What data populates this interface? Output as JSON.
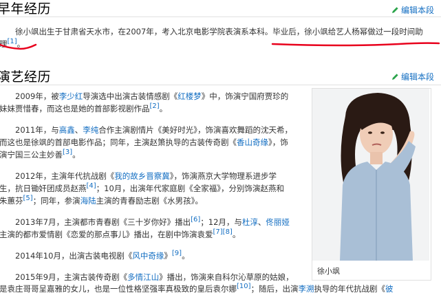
{
  "section1": {
    "title": "早年经历",
    "edit_label": "编辑本段",
    "para": {
      "line1": "徐小飒出生于甘肃省天水市，在2007年，考入北京电影学院表演系本科。毕业后，徐小飒给艺人杨幂做过一段时间助",
      "line2_start": "理",
      "ref": "[1]",
      "line2_end": "。"
    }
  },
  "section2": {
    "title": "演艺经历",
    "edit_label": "编辑本段",
    "paragraphs": {
      "p1": {
        "a": "2009年，被",
        "l1": "李少红",
        "b": "导演选中出演古装情感剧《",
        "l2": "红楼梦",
        "c": "》中，饰演宁国府贾珍的",
        "d": "妹妹贾惜春，而这也是她的首部影视剧作品",
        "ref": "[2]",
        "e": "。"
      },
      "p2": {
        "a": "2011年，与",
        "l1": "高鑫",
        "b": "、",
        "l2": "李纯",
        "c": "合作主演剧情片《美好时光》，饰演喜欢舞蹈的沈天希，",
        "d": "而这也是徐飒的首部电影作品；同年，主演赵箫执导的古装传奇剧《",
        "l3": "香山奇缘",
        "e": "》，饰",
        "f": "演宁国三公主妙善",
        "ref": "[3]",
        "g": "。"
      },
      "p3": {
        "a": "2012年，主演年代抗战剧《",
        "l1": "我的故乡晋察冀",
        "b": "》，饰演燕京大学物理系进步学",
        "c": "生，抗日锄奸团成员赵燕",
        "ref1": "[4]",
        "d": "；10月，出演年代家庭剧《全家福》，分别饰演赵燕和",
        "e": "朱蕙芬",
        "ref2": "[5]",
        "f": "；同年，参演",
        "l2": "海陆",
        "g": "主演的青春励志剧《水男孩》。"
      },
      "p4": {
        "a": "2013年7月，主演都市青春剧《三十岁你好》播出",
        "ref1": "[6]",
        "b": "；12月，与",
        "l1": "杜淳",
        "c": "、",
        "l2": "佟丽娅",
        "d": "主演的都市爱情剧《恋爱的那点事儿》播出，在剧中饰演袁爱",
        "ref2": "[7]",
        "ref3": "[8]",
        "e": "。"
      },
      "p5": {
        "a": "2014年10月，出演古装电视剧《",
        "l1": "风中奇缘",
        "b": "》",
        "ref": "[9]",
        "c": "。"
      },
      "p6": {
        "a": "2015年9月，主演古装传奇剧《",
        "l1": "多情江山",
        "b": "》播出，饰演来自科尔沁草原的姑娘，",
        "c": "是袁庄哥哥呈嘉雅的女儿，也是一位性格坚强率真极致的皇后袁尔娜",
        "ref": "[10]",
        "d": "；随后，出演",
        "l2": "李溯",
        "e": "执导的年代抗战剧《",
        "l3": "彼"
      }
    },
    "photo_caption": "徐小飒"
  },
  "colors": {
    "link": "#136ec2",
    "annotation_red": "#e8001c"
  },
  "icons": {
    "edit": "pencil-icon",
    "photo": "person-photo"
  }
}
